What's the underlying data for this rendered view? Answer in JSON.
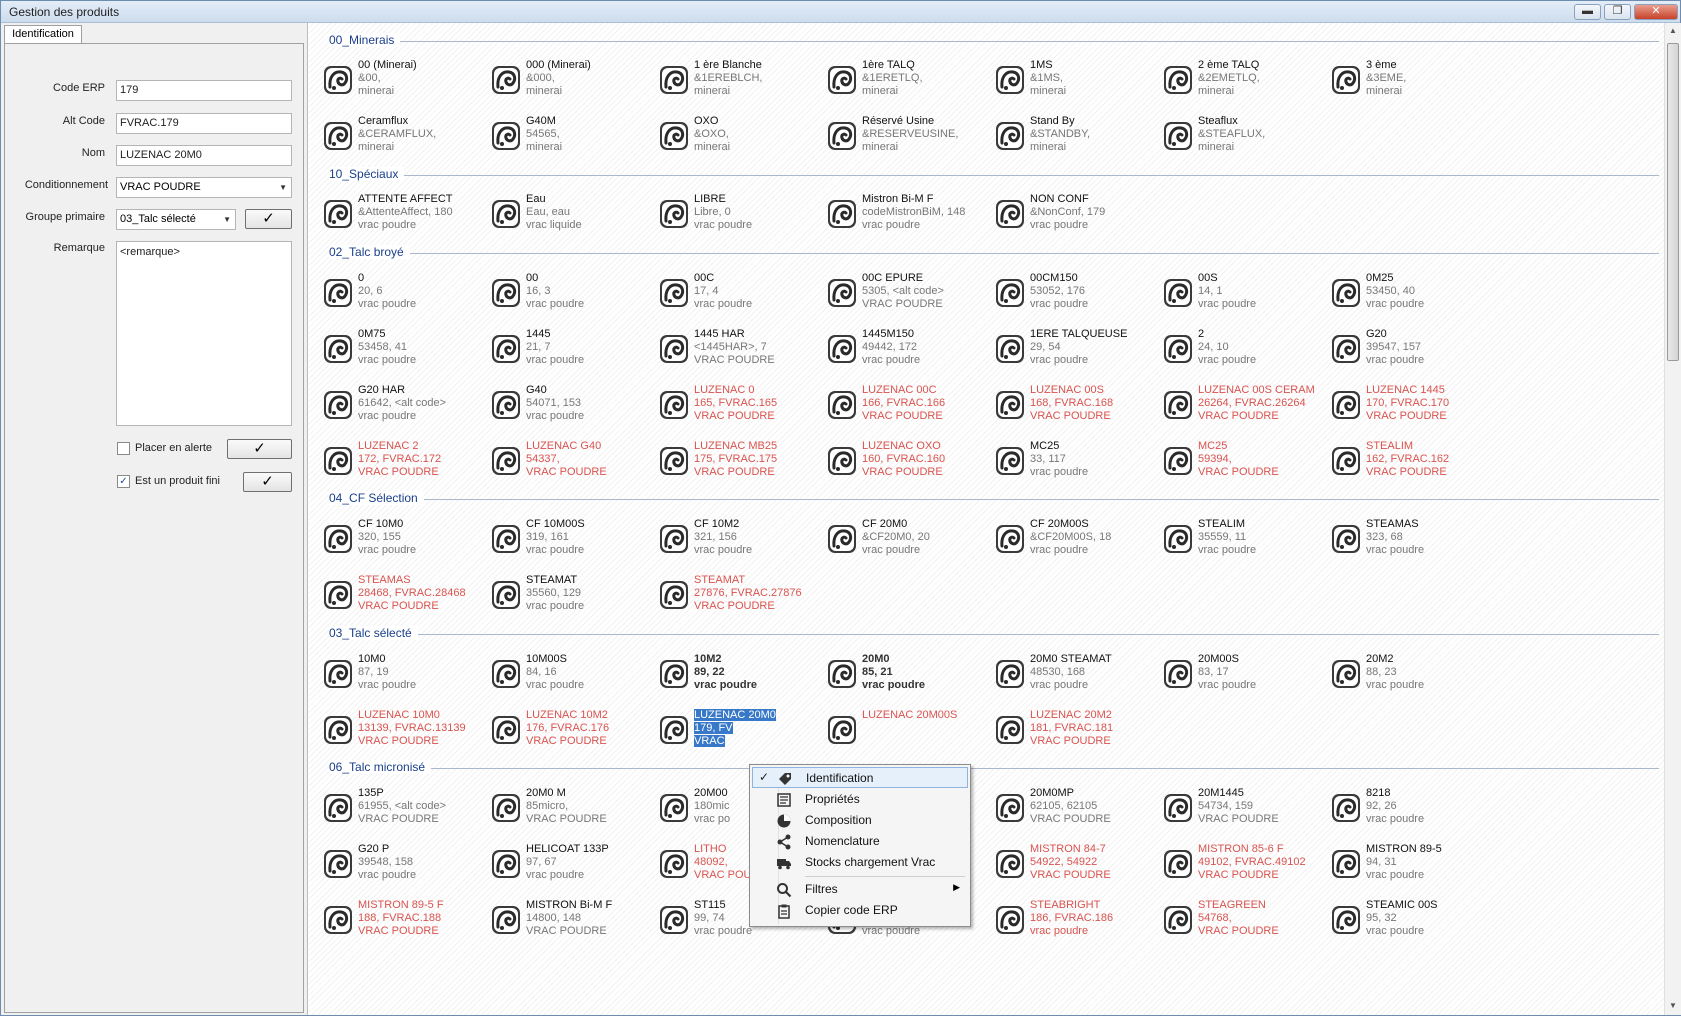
{
  "window": {
    "title": "Gestion des produits",
    "btn_min": "▬",
    "btn_max": "❐",
    "btn_close": "✕"
  },
  "left": {
    "tab": "Identification",
    "labels": {
      "code_erp": "Code ERP",
      "alt_code": "Alt Code",
      "nom": "Nom",
      "cond": "Conditionnement",
      "groupe": "Groupe primaire",
      "remarque": "Remarque"
    },
    "values": {
      "code_erp": "179",
      "alt_code": "FVRAC.179",
      "nom": "LUZENAC 20M0",
      "cond": "VRAC POUDRE",
      "groupe": "03_Talc sélecté",
      "remarque": "<remarque>"
    },
    "check_alerte": {
      "label": "Placer en alerte",
      "checked": false
    },
    "check_fini": {
      "label": "Est un produit fini",
      "checked": true
    },
    "confirm_glyph": "✓"
  },
  "groups": [
    {
      "name": "00_Minerais",
      "rows": [
        [
          [
            "00 (Minerai)",
            "&00,",
            "minerai"
          ],
          [
            "000 (Minerai)",
            "&000,",
            "minerai"
          ],
          [
            "1 ère Blanche",
            "&1EREBLCH,",
            "minerai"
          ],
          [
            "1ère TALQ",
            "&1ERETLQ,",
            "minerai"
          ],
          [
            "1MS",
            "&1MS,",
            "minerai"
          ],
          [
            "2 ème TALQ",
            "&2EMETLQ,",
            "minerai"
          ],
          [
            "3 ème",
            "&3EME,",
            "minerai"
          ]
        ],
        [
          [
            "Ceramflux",
            "&CERAMFLUX,",
            "minerai"
          ],
          [
            "G40M",
            "54565,",
            "minerai"
          ],
          [
            "OXO",
            "&OXO,",
            "minerai"
          ],
          [
            "Réservé Usine",
            "&RESERVEUSINE,",
            "minerai"
          ],
          [
            "Stand By",
            "&STANDBY,",
            "minerai"
          ],
          [
            "Steaflux",
            "&STEAFLUX,",
            "minerai"
          ]
        ]
      ]
    },
    {
      "name": "10_Spéciaux",
      "rows": [
        [
          [
            "ATTENTE AFFECT",
            "&AttenteAffect, 180",
            "vrac poudre"
          ],
          [
            "Eau",
            "Eau, eau",
            "vrac liquide"
          ],
          [
            "LIBRE",
            "Libre, 0",
            "vrac poudre"
          ],
          [
            "Mistron Bi-M F",
            "codeMistronBiM, 148",
            "vrac poudre"
          ],
          [
            "NON CONF",
            "&NonConf, 179",
            "vrac poudre"
          ]
        ]
      ]
    },
    {
      "name": "02_Talc broyé",
      "rows": [
        [
          [
            "0",
            "20, 6",
            "vrac poudre"
          ],
          [
            "00",
            "16, 3",
            "vrac poudre"
          ],
          [
            "00C",
            "17, 4",
            "vrac poudre"
          ],
          [
            "00C EPURE",
            "5305, <alt code>",
            "VRAC POUDRE"
          ],
          [
            "00CM150",
            "53052, 176",
            "vrac poudre"
          ],
          [
            "00S",
            "14, 1",
            "vrac poudre"
          ],
          [
            "0M25",
            "53450, 40",
            "vrac poudre"
          ]
        ],
        [
          [
            "0M75",
            "53458, 41",
            "vrac poudre"
          ],
          [
            "1445",
            "21, 7",
            "vrac poudre"
          ],
          [
            "1445 HAR",
            "<1445HAR>, 7",
            "VRAC POUDRE"
          ],
          [
            "1445M150",
            "49442, 172",
            "vrac poudre"
          ],
          [
            "1ERE TALQUEUSE",
            "29, 54",
            "vrac poudre"
          ],
          [
            "2",
            "24, 10",
            "vrac poudre"
          ],
          [
            "G20",
            "39547, 157",
            "vrac poudre"
          ]
        ],
        [
          [
            "G20 HAR",
            "61642, <alt code>",
            "vrac poudre"
          ],
          [
            "G40",
            "54071, 153",
            "vrac poudre"
          ],
          [
            "LUZENAC 0",
            "165, FVRAC.165",
            "VRAC POUDRE",
            "red"
          ],
          [
            "LUZENAC 00C",
            "166, FVRAC.166",
            "VRAC POUDRE",
            "red"
          ],
          [
            "LUZENAC 00S",
            "168, FVRAC.168",
            "VRAC POUDRE",
            "red"
          ],
          [
            "LUZENAC 00S CERAM",
            "26264, FVRAC.26264",
            "VRAC POUDRE",
            "red"
          ],
          [
            "LUZENAC 1445",
            "170, FVRAC.170",
            "VRAC POUDRE",
            "red"
          ]
        ],
        [
          [
            "LUZENAC 2",
            "172, FVRAC.172",
            "VRAC POUDRE",
            "red"
          ],
          [
            "LUZENAC G40",
            "54337,",
            "VRAC POUDRE",
            "red"
          ],
          [
            "LUZENAC MB25",
            "175, FVRAC.175",
            "VRAC POUDRE",
            "red"
          ],
          [
            "LUZENAC OXO",
            "160, FVRAC.160",
            "VRAC POUDRE",
            "red"
          ],
          [
            "MC25",
            "33, 117",
            "vrac poudre"
          ],
          [
            "MC25",
            "59394,",
            "VRAC POUDRE",
            "red"
          ],
          [
            "STEALIM",
            "162, FVRAC.162",
            "VRAC POUDRE",
            "red"
          ]
        ]
      ]
    },
    {
      "name": "04_CF Sélection",
      "rows": [
        [
          [
            "CF 10M0",
            "320, 155",
            "vrac poudre"
          ],
          [
            "CF 10M00S",
            "319, 161",
            "vrac poudre"
          ],
          [
            "CF 10M2",
            "321, 156",
            "vrac poudre"
          ],
          [
            "CF 20M0",
            "&CF20M0, 20",
            "vrac poudre"
          ],
          [
            "CF 20M00S",
            "&CF20M00S, 18",
            "vrac poudre"
          ],
          [
            "STEALIM",
            "35559, 11",
            "vrac poudre"
          ],
          [
            "STEAMAS",
            "323, 68",
            "vrac poudre"
          ]
        ],
        [
          [
            "STEAMAS",
            "28468, FVRAC.28468",
            "VRAC POUDRE",
            "red"
          ],
          [
            "STEAMAT",
            "35560, 129",
            "vrac poudre"
          ],
          [
            "STEAMAT",
            "27876, FVRAC.27876",
            "VRAC POUDRE",
            "red"
          ]
        ]
      ]
    },
    {
      "name": "03_Talc sélecté",
      "rows": [
        [
          [
            "10M0",
            "87, 19",
            "vrac poudre"
          ],
          [
            "10M00S",
            "84, 16",
            "vrac poudre"
          ],
          [
            "10M2",
            "89, 22",
            "vrac poudre",
            "bold"
          ],
          [
            "20M0",
            "85, 21",
            "vrac poudre",
            "bold"
          ],
          [
            "20M0 STEAMAT",
            "48530, 168",
            "vrac poudre"
          ],
          [
            "20M00S",
            "83, 17",
            "vrac poudre"
          ],
          [
            "20M2",
            "88, 23",
            "vrac poudre"
          ]
        ],
        [
          [
            "LUZENAC 10M0",
            "13139, FVRAC.13139",
            "VRAC POUDRE",
            "red"
          ],
          [
            "LUZENAC 10M2",
            "176, FVRAC.176",
            "VRAC POUDRE",
            "red"
          ],
          [
            "LUZENAC 20M0",
            "179, FV",
            "VRAC",
            "sel1"
          ],
          [
            "LUZENAC 20M00S",
            "",
            "",
            "red"
          ],
          [
            "LUZENAC 20M2",
            "181, FVRAC.181",
            "VRAC POUDRE",
            "red"
          ]
        ]
      ]
    },
    {
      "name": "06_Talc micronisé",
      "rows": [
        [
          [
            "135P",
            "61955, <alt code>",
            "VRAC POUDRE"
          ],
          [
            "20M0 M",
            "85micro,",
            "VRAC POUDRE"
          ],
          [
            "20M00",
            "180mic",
            "vrac po"
          ],
          [
            "",
            "",
            ""
          ],
          [
            "20M0MP",
            "62105, 62105",
            "VRAC POUDRE"
          ],
          [
            "20M1445",
            "54734, 159",
            "VRAC POUDRE"
          ],
          [
            "8218",
            "92, 26",
            "vrac poudre"
          ]
        ],
        [
          [
            "G20 P",
            "39548, 158",
            "vrac poudre"
          ],
          [
            "HELICOAT 133P",
            "97, 67",
            "vrac poudre"
          ],
          [
            "LITHO",
            "48092,",
            "VRAC POUDRE",
            "red"
          ],
          [
            "",
            "",
            ""
          ],
          [
            "MISTRON 84-7",
            "54922, 54922",
            "VRAC POUDRE",
            "red"
          ],
          [
            "MISTRON 85-6 F",
            "49102, FVRAC.49102",
            "VRAC POUDRE",
            "red"
          ],
          [
            "MISTRON 89-5",
            "94, 31",
            "vrac poudre"
          ]
        ],
        [
          [
            "MISTRON 89-5 F",
            "188, FVRAC.188",
            "VRAC POUDRE",
            "red"
          ],
          [
            "MISTRON Bi-M F",
            "14800, 148",
            "VRAC POUDRE"
          ],
          [
            "ST115",
            "99, 74",
            "vrac poudre"
          ],
          [
            "STEABRIGHT",
            "98, 72",
            "vrac poudre"
          ],
          [
            "STEABRIGHT",
            "186, FVRAC.186",
            "vrac poudre",
            "red"
          ],
          [
            "STEAGREEN",
            "54768,",
            "VRAC POUDRE",
            "red"
          ],
          [
            "STEAMIC 00S",
            "95, 32",
            "vrac poudre"
          ]
        ]
      ]
    }
  ],
  "context_menu": {
    "items": [
      {
        "label": "Identification",
        "icon": "tag-icon",
        "checked": "✓",
        "highlight": true
      },
      {
        "label": "Propriétés",
        "icon": "properties-icon"
      },
      {
        "label": "Composition",
        "icon": "pie-chart-icon"
      },
      {
        "label": "Nomenclature",
        "icon": "share-tree-icon"
      },
      {
        "label": "Stocks chargement Vrac",
        "icon": "truck-icon"
      },
      {
        "label": "Filtres",
        "icon": "magnifier-icon",
        "submenu": "▶"
      },
      {
        "label": "Copier code ERP",
        "icon": "clipboard-icon"
      }
    ]
  },
  "colors": {
    "group_title": "#1b3f8b",
    "red_item": "#d9534f",
    "selection": "#3778c9"
  }
}
